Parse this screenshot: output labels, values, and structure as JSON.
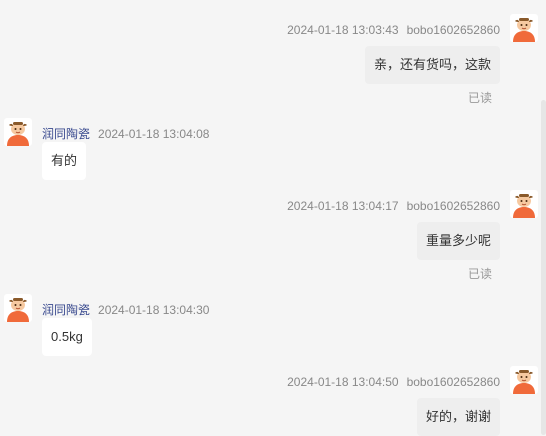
{
  "messages": [
    {
      "side": "out",
      "time": "2024-01-18 13:03:43",
      "user": "bobo1602652860",
      "text": "亲，还有货吗，这款",
      "read": "已读"
    },
    {
      "side": "in",
      "name": "润同陶瓷",
      "time": "2024-01-18 13:04:08",
      "text": "有的"
    },
    {
      "side": "out",
      "time": "2024-01-18 13:04:17",
      "user": "bobo1602652860",
      "text": "重量多少呢",
      "read": "已读"
    },
    {
      "side": "in",
      "name": "润同陶瓷",
      "time": "2024-01-18 13:04:30",
      "text": "0.5kg"
    },
    {
      "side": "out",
      "time": "2024-01-18 13:04:50",
      "user": "bobo1602652860",
      "text": "好的，谢谢"
    }
  ],
  "avatar_icon": "cartoon-avatar-icon",
  "colors": {
    "background": "#f5f5f5",
    "incoming_bubble": "#ffffff",
    "outgoing_bubble": "#eeeeee",
    "shop_name": "#3a4a8f",
    "avatar_orange": "#f06a3a"
  }
}
